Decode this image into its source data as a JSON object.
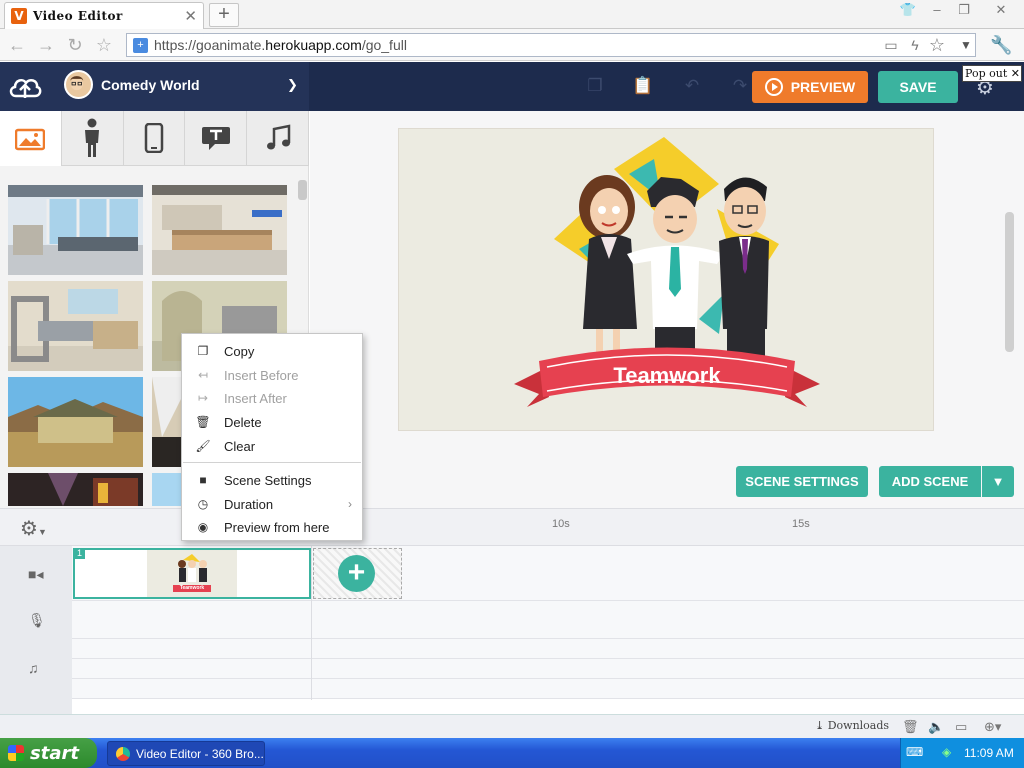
{
  "browser": {
    "tab_icon_letter": "V",
    "tab_title": "Video Editor",
    "url_prefix": "https://goanimate.",
    "url_domain": "herokuapp.com",
    "url_path": "/go_full",
    "popout_label": "Pop out"
  },
  "header": {
    "theme_name": "Comedy World",
    "preview_label": "PREVIEW",
    "save_label": "SAVE"
  },
  "library": {
    "tabs": [
      "image-icon",
      "character-icon",
      "phone-icon",
      "text-bubble-icon",
      "music-icon"
    ]
  },
  "stage": {
    "banner_text": "Teamwork",
    "scene_settings_label": "SCENE SETTINGS",
    "add_scene_label": "ADD SCENE"
  },
  "context_menu": {
    "items": [
      {
        "label": "Copy",
        "icon": "copy-icon",
        "enabled": true
      },
      {
        "label": "Insert Before",
        "icon": "insert-before-icon",
        "enabled": false
      },
      {
        "label": "Insert After",
        "icon": "insert-after-icon",
        "enabled": false
      },
      {
        "label": "Delete",
        "icon": "trash-icon",
        "enabled": true
      },
      {
        "label": "Clear",
        "icon": "brush-icon",
        "enabled": true
      },
      {
        "label": "Scene Settings",
        "icon": "camera-icon",
        "enabled": true
      },
      {
        "label": "Duration",
        "icon": "clock-icon",
        "enabled": true
      },
      {
        "label": "Preview from here",
        "icon": "eye-icon",
        "enabled": true
      }
    ]
  },
  "timeline": {
    "tick_10": "10s",
    "tick_15": "15s",
    "scene_number": "1",
    "thumb_banner": "Teamwork"
  },
  "statusbar": {
    "downloads_label": "Downloads"
  },
  "taskbar": {
    "start_label": "start",
    "task_label": "Video Editor - 360 Bro...",
    "clock": "11:09 AM"
  },
  "colors": {
    "accent_teal": "#3bb39f",
    "accent_orange": "#ef7b2b",
    "header_navy": "#1d2b4d"
  }
}
